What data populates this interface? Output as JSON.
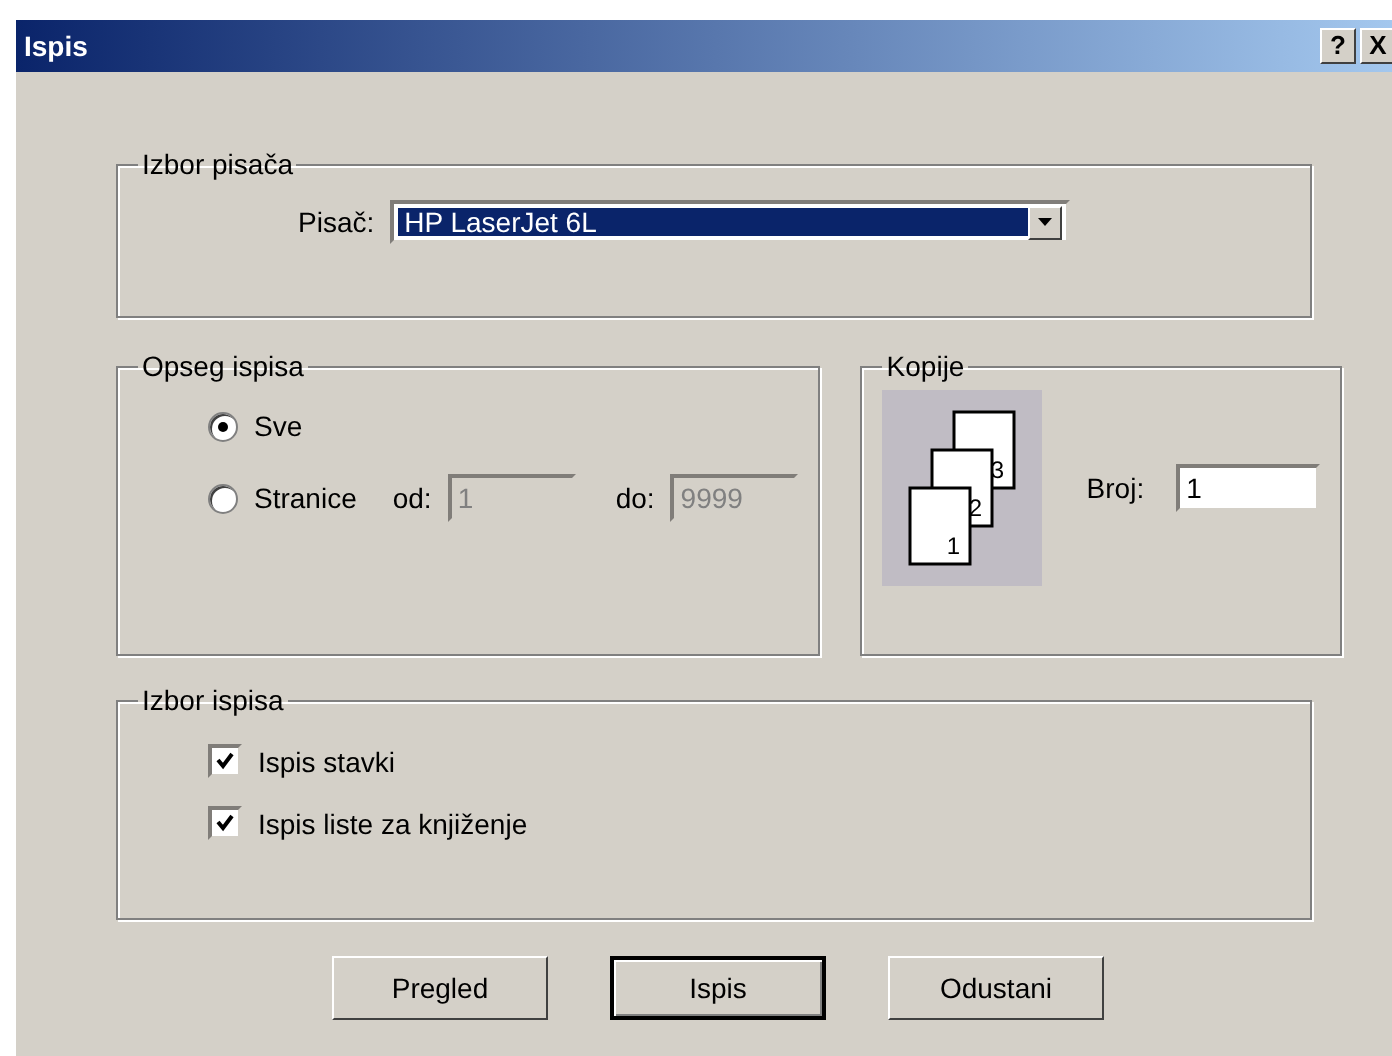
{
  "window": {
    "title": "Ispis",
    "title_buttons": [
      "?",
      "X"
    ]
  },
  "printer_group": {
    "title": "Izbor pisača",
    "label": "Pisač:",
    "value": "HP LaserJet 6L"
  },
  "range_group": {
    "title": "Opseg ispisa",
    "options": [
      {
        "label": "Sve",
        "selected": true
      },
      {
        "label": "Stranice",
        "selected": false
      }
    ],
    "from_label": "od:",
    "from_value": "1",
    "to_label": "do:",
    "to_value": "9999",
    "disabled": true
  },
  "copies_group": {
    "title": "Kopije",
    "page_numbers": [
      "1",
      "2",
      "3"
    ],
    "label": "Broj:",
    "value": "1"
  },
  "options_group": {
    "title": "Izbor ispisa",
    "items": [
      {
        "label": "Ispis stavki",
        "checked": true
      },
      {
        "label": "Ispis liste za knjiženje",
        "checked": true
      }
    ]
  },
  "buttons": [
    {
      "label": "Pregled",
      "default": false
    },
    {
      "label": "Ispis",
      "default": true
    },
    {
      "label": "Odustani",
      "default": false
    }
  ]
}
